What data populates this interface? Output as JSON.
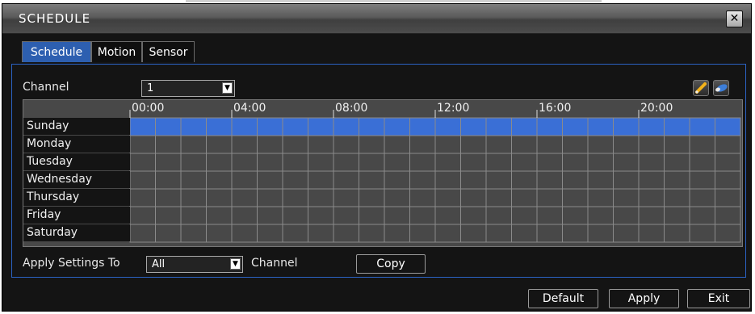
{
  "window": {
    "title": "SCHEDULE",
    "close_label": "✕"
  },
  "tabs": [
    {
      "label": "Schedule",
      "active": true
    },
    {
      "label": "Motion",
      "active": false
    },
    {
      "label": "Sensor",
      "active": false
    }
  ],
  "channel": {
    "label": "Channel",
    "value": "1"
  },
  "toolbar": {
    "icons": [
      "pencil-icon",
      "eraser-icon"
    ]
  },
  "schedule_grid": {
    "hour_labels": [
      "00:00",
      "04:00",
      "08:00",
      "12:00",
      "16:00",
      "20:00"
    ],
    "days": [
      "Sunday",
      "Monday",
      "Tuesday",
      "Wednesday",
      "Thursday",
      "Friday",
      "Saturday"
    ],
    "recording_all_day": [
      "Sunday"
    ],
    "colors": {
      "recording": "#3a6fd6",
      "empty": "#484848",
      "gridline": "#8a8a8a"
    }
  },
  "apply_settings": {
    "label": "Apply Settings To",
    "value": "All",
    "suffix": "Channel",
    "copy_label": "Copy"
  },
  "footer": {
    "default_label": "Default",
    "apply_label": "Apply",
    "exit_label": "Exit"
  }
}
